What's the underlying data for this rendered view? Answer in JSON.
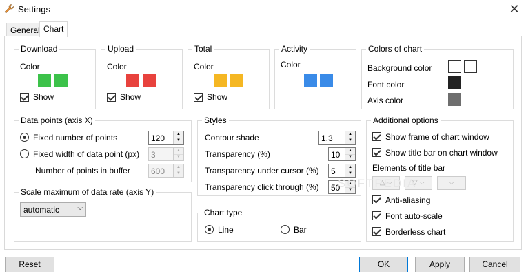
{
  "window": {
    "title": "Settings",
    "close_glyph": "✕"
  },
  "tabs": [
    {
      "label": "General",
      "active": false
    },
    {
      "label": "Chart",
      "active": true
    }
  ],
  "download": {
    "title": "Download",
    "color_label": "Color",
    "show_label": "Show",
    "color": "#3cc24a",
    "show_checked": true
  },
  "upload": {
    "title": "Upload",
    "color_label": "Color",
    "show_label": "Show",
    "color": "#e8423d",
    "show_checked": true
  },
  "total": {
    "title": "Total",
    "color_label": "Color",
    "show_label": "Show",
    "color": "#f5b723",
    "show_checked": true
  },
  "activity": {
    "title": "Activity",
    "color_label": "Color",
    "color": "#3a8be8"
  },
  "colors_of_chart": {
    "title": "Colors of chart",
    "background_label": "Background color",
    "background_color": "#ffffff",
    "font_label": "Font color",
    "font_color": "#222222",
    "axis_label": "Axis color",
    "axis_color": "#6e6e6e"
  },
  "data_points": {
    "title": "Data points (axis X)",
    "fixed_number_label": "Fixed number of points",
    "fixed_number_value": "120",
    "fixed_number_selected": true,
    "fixed_width_label": "Fixed width of data point (px)",
    "fixed_width_value": "3",
    "fixed_width_selected": false,
    "buffer_label": "Number of points in buffer",
    "buffer_value": "600"
  },
  "scale": {
    "title": "Scale maximum of data rate (axis Y)",
    "selected": "automatic"
  },
  "styles": {
    "title": "Styles",
    "contour_label": "Contour shade",
    "contour_value": "1.3",
    "transparency_label": "Transparency (%)",
    "transparency_value": "10",
    "under_cursor_label": "Transparency under cursor (%)",
    "under_cursor_value": "5",
    "click_through_label": "Transparency click through (%)",
    "click_through_value": "50"
  },
  "chart_type": {
    "title": "Chart type",
    "line_label": "Line",
    "bar_label": "Bar",
    "selected": "Line"
  },
  "additional": {
    "title": "Additional options",
    "show_frame_label": "Show frame of chart window",
    "show_title_bar_label": "Show title bar on chart window",
    "elements_label": "Elements of title bar",
    "anti_aliasing_label": "Anti-aliasing",
    "font_autoscale_label": "Font auto-scale",
    "borderless_label": "Borderless chart"
  },
  "watermark": "SOFTPEDIA",
  "footer": {
    "reset_label": "Reset",
    "ok_label": "OK",
    "apply_label": "Apply",
    "cancel_label": "Cancel"
  }
}
